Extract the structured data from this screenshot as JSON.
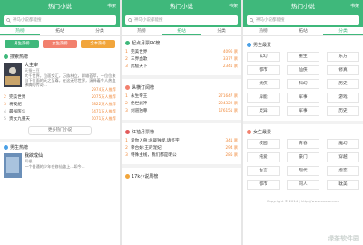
{
  "app": {
    "title": "热门小说",
    "shelf_label": "书架"
  },
  "search": {
    "placeholder": "神马小说都能搜"
  },
  "tabs": [
    "热榜",
    "拓站",
    "分类"
  ],
  "panel1": {
    "buttons": [
      {
        "label": "男生热榜",
        "color": "#3fb87b"
      },
      {
        "label": "女生热榜",
        "color": "#f2806d"
      },
      {
        "label": "全本热榜",
        "color": "#f1a53b"
      }
    ],
    "section1_title": "搜索热榜",
    "featured": {
      "title": "大主宰",
      "author": "天蚕土豆",
      "desc": "大千世界，位面交汇，万族林立，群雄荟萃，一位位来自下位面的天之至尊，在这无尽世界，演绎着令人热血沸腾的传奇...",
      "count": "2974万人推荐"
    },
    "ranks": [
      {
        "num": "2",
        "title": "完美世界",
        "count": "2075万人推荐"
      },
      {
        "num": "3",
        "title": "将夜纪",
        "count": "1822万人推荐"
      },
      {
        "num": "4",
        "title": "最强医少",
        "count": "1471万人推荐"
      },
      {
        "num": "5",
        "title": "贵女九重天",
        "count": "1071万人推荐"
      }
    ],
    "more": "更多热门小说",
    "section2_title": "男生热榜",
    "featured2": {
      "title": "我欲成仙",
      "author": "耳根",
      "desc": "一个普通的少年在修仙路上...如今..."
    }
  },
  "panel2": {
    "sections": [
      {
        "title": "起点月票PK榜",
        "items": [
          {
            "num": "1",
            "title": "完美世界",
            "count": "4096 票"
          },
          {
            "num": "2",
            "title": "三界血歌",
            "count": "3377 票"
          },
          {
            "num": "3",
            "title": "武极天下",
            "count": "2341 票"
          }
        ]
      },
      {
        "title": "纵横订阅榜",
        "items": [
          {
            "num": "1",
            "title": "永生帝王",
            "count": "271647 票"
          },
          {
            "num": "2",
            "title": "绝世武神",
            "count": "204322 票"
          },
          {
            "num": "3",
            "title": "剑道独尊",
            "count": "176151 票"
          }
        ]
      },
      {
        "title": "红袖月票榜",
        "items": [
          {
            "num": "1",
            "title": "爱你入骨:总裁独宠,请签字",
            "count": "341 票"
          },
          {
            "num": "2",
            "title": "帝台娇:王的宠妃",
            "count": "294 票"
          },
          {
            "num": "3",
            "title": "特殊主线，我们都是明公",
            "count": "285 票"
          }
        ]
      },
      {
        "title": "17k小说周榜",
        "items": []
      }
    ]
  },
  "panel3": {
    "male_title": "男生最爱",
    "male_tags": [
      "玄幻",
      "重生",
      "东方",
      "都市",
      "仙侠",
      "修真",
      "武侠",
      "科幻",
      "历史",
      "异能",
      "军事",
      "游戏",
      "灵异",
      "军事",
      "历史"
    ],
    "female_title": "女生最爱",
    "female_tags": [
      "校园",
      "青春",
      "魔幻",
      "纯爱",
      "豪门",
      "穿越",
      "古言",
      "现代",
      "虐恋",
      "都市",
      "同人",
      "耽美"
    ],
    "footer": "Copyright © 2014 | http://www.xxxxx.com",
    "watermark": "绿茶软件园"
  }
}
